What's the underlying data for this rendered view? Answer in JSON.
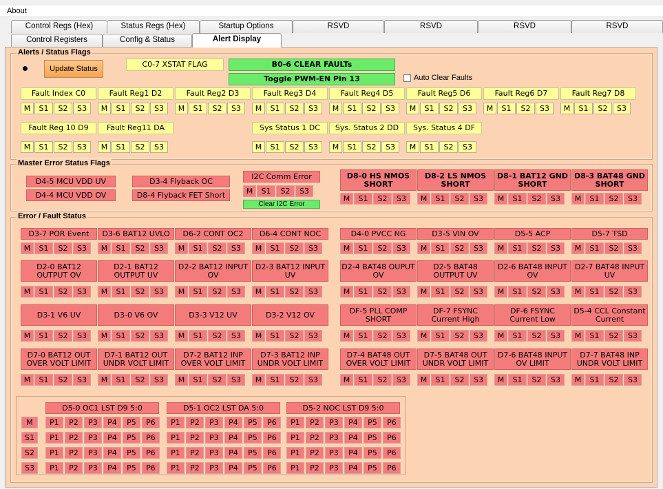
{
  "menu": {
    "about": "About"
  },
  "tabs_row1": [
    "Control Regs (Hex)",
    "Status Regs (Hex)",
    "Startup Options",
    "RSVD",
    "RSVD",
    "RSVD",
    "RSVD"
  ],
  "tabs_row2": [
    "Control Registers",
    "Config & Status",
    "Alert Display"
  ],
  "alerts": {
    "legend": "Alerts / Status Flags",
    "update_status": "Update Status",
    "xstat": "C0-7 XSTAT FLAG",
    "clear_faults": "B0-6 CLEAR FAULTs",
    "toggle_pwm": "Toggle PWM-EN Pin 13",
    "auto_clear": "Auto Clear Faults",
    "row1": [
      "Fault Index C0",
      "Fault Reg1 D2",
      "Fault Reg2 D3",
      "Fault Reg3 D4",
      "Fault Reg4 D5",
      "Fault Reg5 D6",
      "Fault Reg6 D7",
      "Fault Reg7 D8"
    ],
    "row2a": [
      "Fault Reg 10 D9",
      "Fault Reg11 DA"
    ],
    "row2b": [
      "Sys  Status 1 DC",
      "Sys. Status 2  DD",
      "Sys. Status 4 DF"
    ],
    "cells": [
      "M",
      "S1",
      "S2",
      "S3"
    ]
  },
  "master": {
    "legend": "Master Error Status  Flags",
    "items": [
      "D4-5 MCU VDD UV",
      "D4-4 MCU VDD OV",
      "D3-4 Flyback OC",
      "D8-4 Flyback FET Short"
    ],
    "i2c_error": "I2C Comm Error",
    "clear_i2c": "Clear I2C Error",
    "shorts": [
      "D8-0 HS NMOS SHORT",
      "D8-2 LS NMOS SHORT",
      "D8-1 BAT12 GND SHORT",
      "D8-3 BAT48 GND SHORT"
    ]
  },
  "errors": {
    "legend": "Error / Fault Status",
    "row1": [
      "D3-7 POR Event",
      "D3-6 BAT12 UVLO",
      "D6-2 CONT OC2",
      "D6-4 CONT NOC",
      "D4-0 PVCC NG",
      "D3-5 VIN OV",
      "D5-5 ACP",
      "D5-7 TSD"
    ],
    "row2": [
      "D2-0 BAT12 OUTPUT OV",
      "D2-1 BAT12 OUTPUT UV",
      "D2-2 BAT12 INPUT OV",
      "D2-3 BAT12 INPUT UV",
      "D2-4 BAT48 OUPUT OV",
      "D2-5 BAT48 OUTPUT UV",
      "D2-6 BAT48 INPUT OV",
      "D2-7 BAT48 INPUT UV"
    ],
    "row3": [
      "D3-1 V6 UV",
      "D3-0 V6 OV",
      "D3-3 V12 UV",
      "D3-2 V12 OV",
      "DF-5 PLL COMP SHORT",
      "DF-7 FSYNC Current High",
      "DF-6 FSYNC Current Low",
      "D5-4  CCL Constant Current"
    ],
    "row4": [
      "D7-0 BAT12 OUT OVER VOLT LIMIT",
      "D7-1 BAT12 OUT UNDR VOLT LIMIT",
      "D7-2 BAT12 INP OVER VOLT LIMIT",
      "D7-3 BAT12 INP UNDR VOLT LIMIT",
      "D7-4 BAT48 OUT OVER VOLT LIMIT",
      "D7-5 BAT48 OUT UNDR VOLT LIMIT",
      "D7-6 BAT48 INPUT OV LIMIT",
      "D7-7 BAT48 INP UNDR VOLT LIMIT"
    ],
    "phase_headers": [
      "D5-0 OC1  LST D9 5:0",
      "D5-1 OC2  LST DA 5:0",
      "D5-2 NOC  LST D9 5:0"
    ],
    "phase_rows": [
      "M",
      "S1",
      "S2",
      "S3"
    ],
    "phases": [
      "P1",
      "P2",
      "P3",
      "P4",
      "P5",
      "P6"
    ]
  },
  "colors": {
    "yellow": "#ffff99",
    "red": "#f47b7b",
    "green": "#6aec6a",
    "panel": "#fcd4b4"
  }
}
